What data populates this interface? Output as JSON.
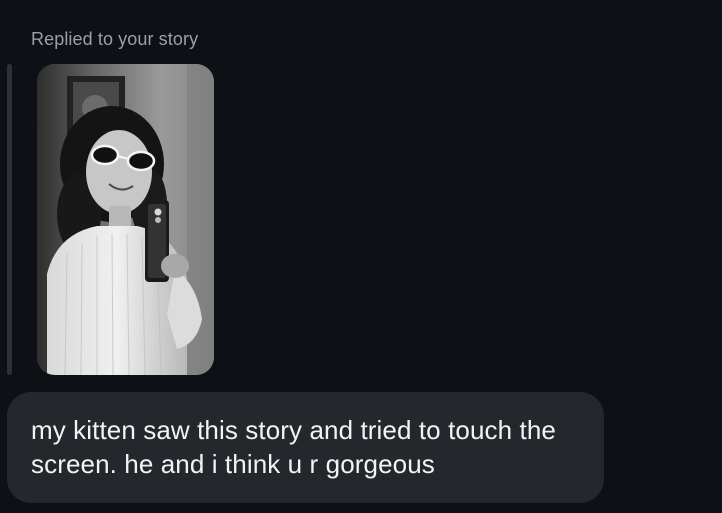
{
  "thread": {
    "reply_label": "Replied to your story",
    "story_image_alt": "black and white mirror selfie",
    "message_text": "my kitten saw this story and tried to touch the screen. he and i think u r gorgeous"
  },
  "theme": {
    "background": "#0d1015",
    "bubble": "#25272c",
    "text": "#f2f3f5",
    "muted_text": "#9aa0a8"
  }
}
